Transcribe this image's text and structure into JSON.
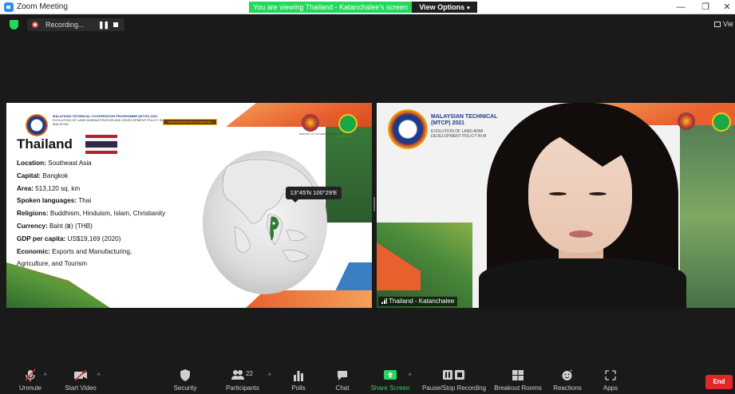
{
  "window": {
    "title": "Zoom Meeting",
    "minimize": "—",
    "restore": "❐",
    "close": "✕"
  },
  "banner": {
    "viewing_text": "You are viewing Thailand - Katanchalee's screen",
    "view_options_label": "View Options",
    "view_options_caret": "▾",
    "accent_color": "#23d959"
  },
  "recording": {
    "label": "Recording...",
    "pause_glyph": "❚❚"
  },
  "view_top": {
    "label": "Vie"
  },
  "slide": {
    "program_title": "MALAYSIAN TECHNICAL COOPERATION PROGRAMME (MTCP) 2021",
    "program_sub": "EVOLUTION OF LAND ADMINISTRATION AND DEVELOPMENT POLICY IN MALAYSIA",
    "caption_strip": "DEVELOPMENT POLICY IN MALAYSIA",
    "crest_label": "MINISTRY OF NATURAL RESOURCES",
    "instun_label": "INSTUN",
    "country": "Thailand",
    "facts": [
      {
        "label": "Location:",
        "value": " Southeast Asia"
      },
      {
        "label": "Capital:",
        "value": " Bangkok"
      },
      {
        "label": "Area:",
        "value": " 513,120 sq. km"
      },
      {
        "label": "Spoken languages:",
        "value": " Thai"
      },
      {
        "label": "Religions:",
        "value": " Buddhism, Hinduism, Islam, Christianity"
      },
      {
        "label": "Currency:",
        "value": " Baht (฿) (THB)"
      },
      {
        "label": "GDP per capita:",
        "value": " US$19,169 (2020)"
      },
      {
        "label": "Economic:",
        "value": " Exports and Manufacturing,"
      },
      {
        "label": "",
        "value": " Agriculture, and Tourism"
      }
    ],
    "coordinates": "13°45′N 100°29′E"
  },
  "video": {
    "title": "MALAYSIAN TECHNICAL (MTCP) 2021",
    "subtitle": "EVOLUTION OF LAND ADMI DEVELOPMENT POLICY IN M",
    "participant_name": "Thailand - Katanchalee"
  },
  "toolbar": {
    "unmute": "Unmute",
    "start_video": "Start Video",
    "security": "Security",
    "participants": "Participants",
    "participants_count": "22",
    "polls": "Polls",
    "chat": "Chat",
    "share_screen": "Share Screen",
    "pause_stop_recording": "Pause/Stop Recording",
    "breakout_rooms": "Breakout Rooms",
    "reactions": "Reactions",
    "apps": "Apps",
    "end": "End",
    "end_color": "#e02828",
    "share_color": "#23d959"
  }
}
